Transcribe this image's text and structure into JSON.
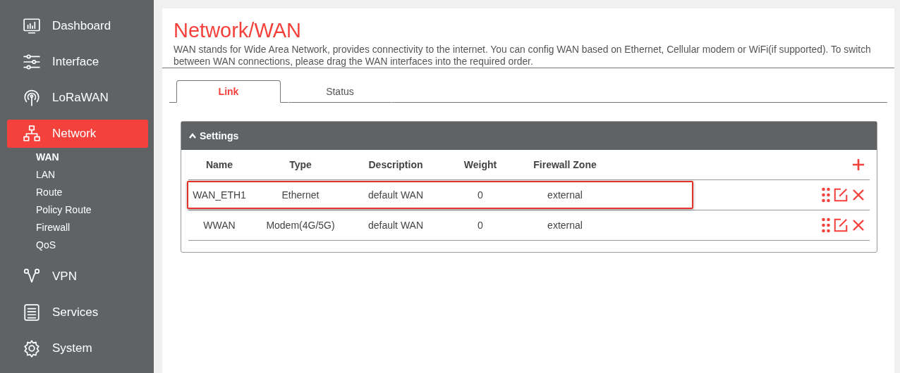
{
  "sidebar": {
    "items": [
      {
        "kind": "dashboard",
        "label": "Dashboard",
        "selected": false
      },
      {
        "kind": "interface",
        "label": "Interface",
        "selected": false
      },
      {
        "kind": "lorawan",
        "label": "LoRaWAN",
        "selected": false
      },
      {
        "kind": "network",
        "label": "Network",
        "selected": true,
        "children": [
          {
            "label": "WAN",
            "selected": true
          },
          {
            "label": "LAN",
            "selected": false
          },
          {
            "label": "Route",
            "selected": false
          },
          {
            "label": "Policy Route",
            "selected": false
          },
          {
            "label": "Firewall",
            "selected": false
          },
          {
            "label": "QoS",
            "selected": false
          }
        ]
      },
      {
        "kind": "vpn",
        "label": "VPN",
        "selected": false
      },
      {
        "kind": "services",
        "label": "Services",
        "selected": false
      },
      {
        "kind": "system",
        "label": "System",
        "selected": false
      }
    ]
  },
  "page": {
    "title": "Network/WAN",
    "description": "WAN stands for Wide Area Network, provides connectivity to the internet. You can config WAN based on Ethernet, Cellular modem or WiFi(if supported). To switch between WAN connections, please drag the WAN interfaces into the required order."
  },
  "tabs": [
    {
      "label": "Link",
      "selected": true
    },
    {
      "label": "Status",
      "selected": false
    }
  ],
  "settings": {
    "title": "Settings",
    "expanded": true,
    "table": {
      "columns": [
        "Name",
        "Type",
        "Description",
        "Weight",
        "Firewall Zone"
      ],
      "rows": [
        {
          "cells": [
            "WAN_ETH1",
            "Ethernet",
            "default WAN",
            "0",
            "external"
          ],
          "highlighted": true
        },
        {
          "cells": [
            "WWAN",
            "Modem(4G/5G)",
            "default WAN",
            "0",
            "external"
          ],
          "highlighted": false
        }
      ]
    }
  }
}
